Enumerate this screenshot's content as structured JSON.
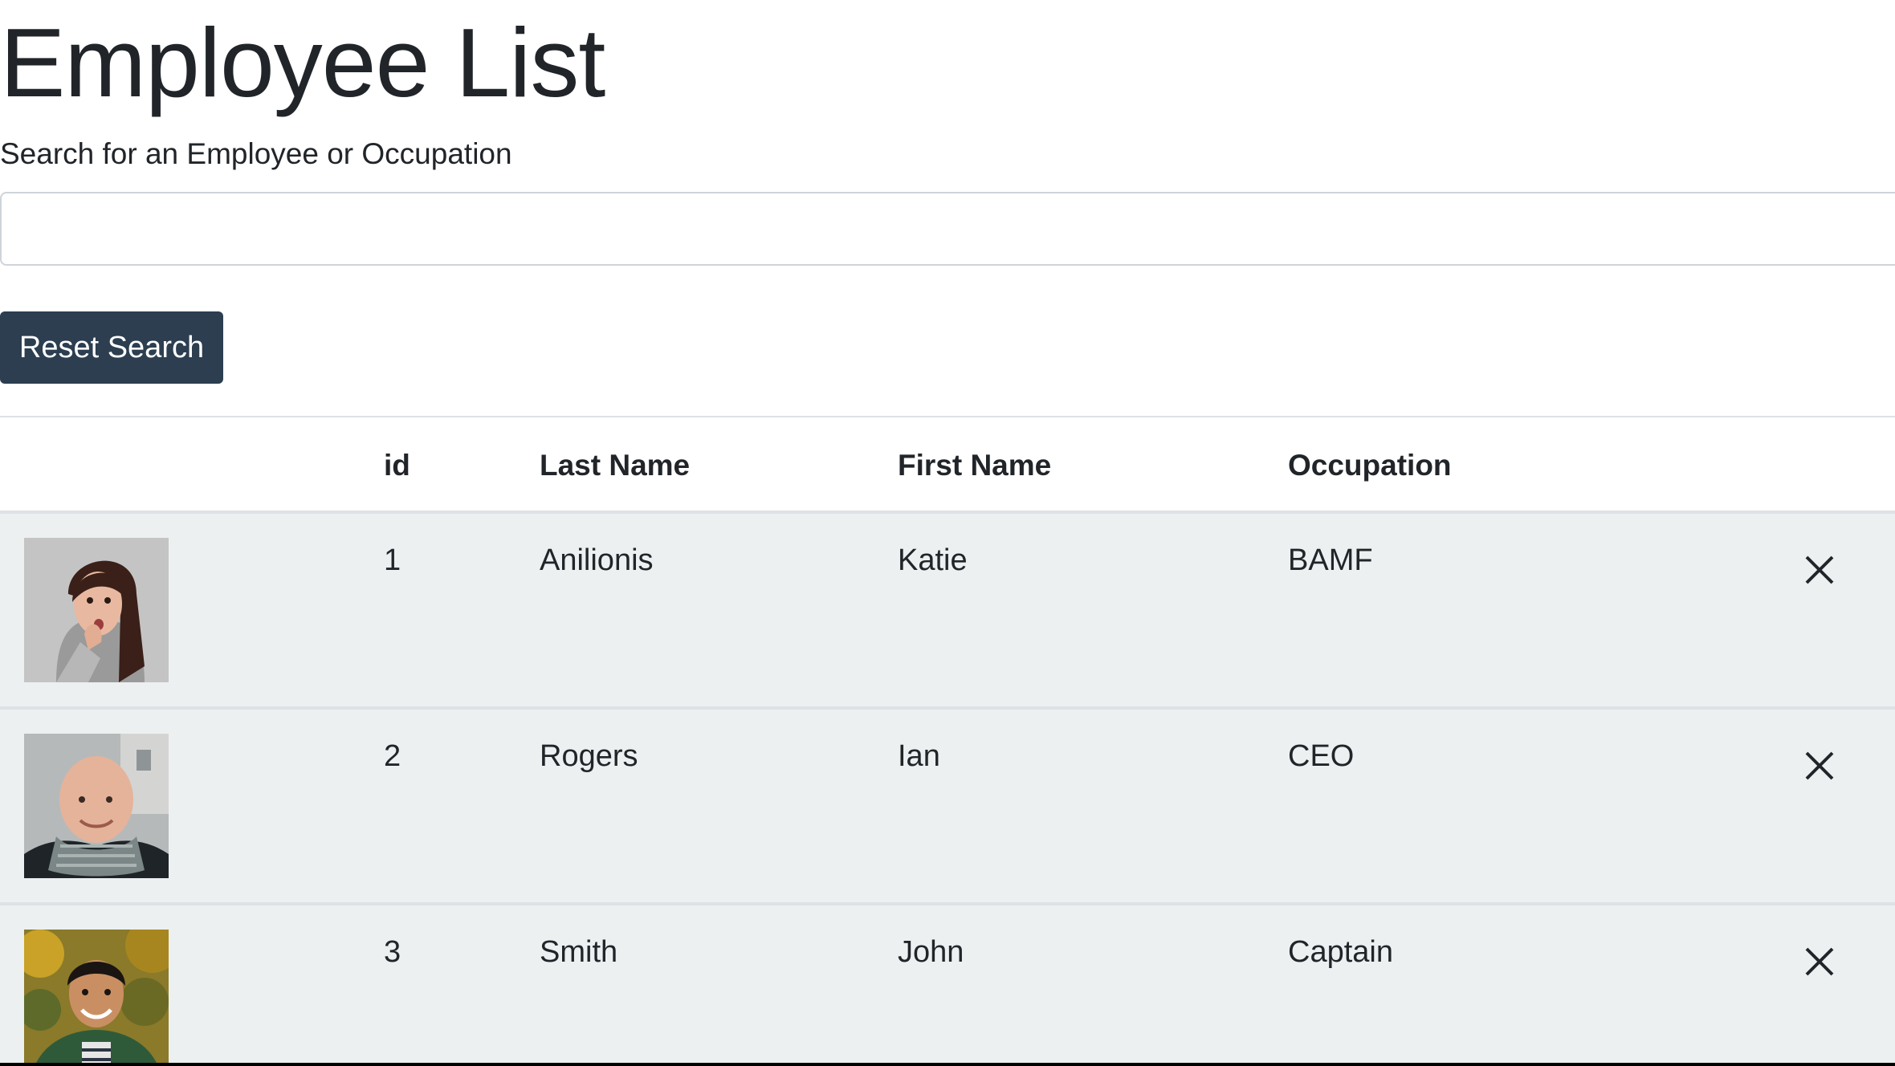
{
  "page": {
    "title": "Employee List"
  },
  "search": {
    "label": "Search for an Employee or Occupation",
    "value": "",
    "placeholder": ""
  },
  "reset_button": {
    "label": "Reset Search"
  },
  "table": {
    "headers": {
      "image": "",
      "id": "id",
      "last_name": "Last Name",
      "first_name": "First Name",
      "occupation": "Occupation"
    },
    "rows": [
      {
        "id": "1",
        "last_name": "Anilionis",
        "first_name": "Katie",
        "occupation": "BAMF",
        "avatar": "woman-surprised-photo",
        "delete_icon": "close-icon"
      },
      {
        "id": "2",
        "last_name": "Rogers",
        "first_name": "Ian",
        "occupation": "CEO",
        "avatar": "bald-man-scarf-photo",
        "delete_icon": "close-icon"
      },
      {
        "id": "3",
        "last_name": "Smith",
        "first_name": "John",
        "occupation": "Captain",
        "avatar": "smiling-man-green-jacket-photo",
        "delete_icon": "close-icon"
      }
    ]
  },
  "colors": {
    "button_bg": "#2c3e50",
    "row_bg": "#ecf0f1",
    "text": "#212529",
    "border": "#dee2e6"
  }
}
